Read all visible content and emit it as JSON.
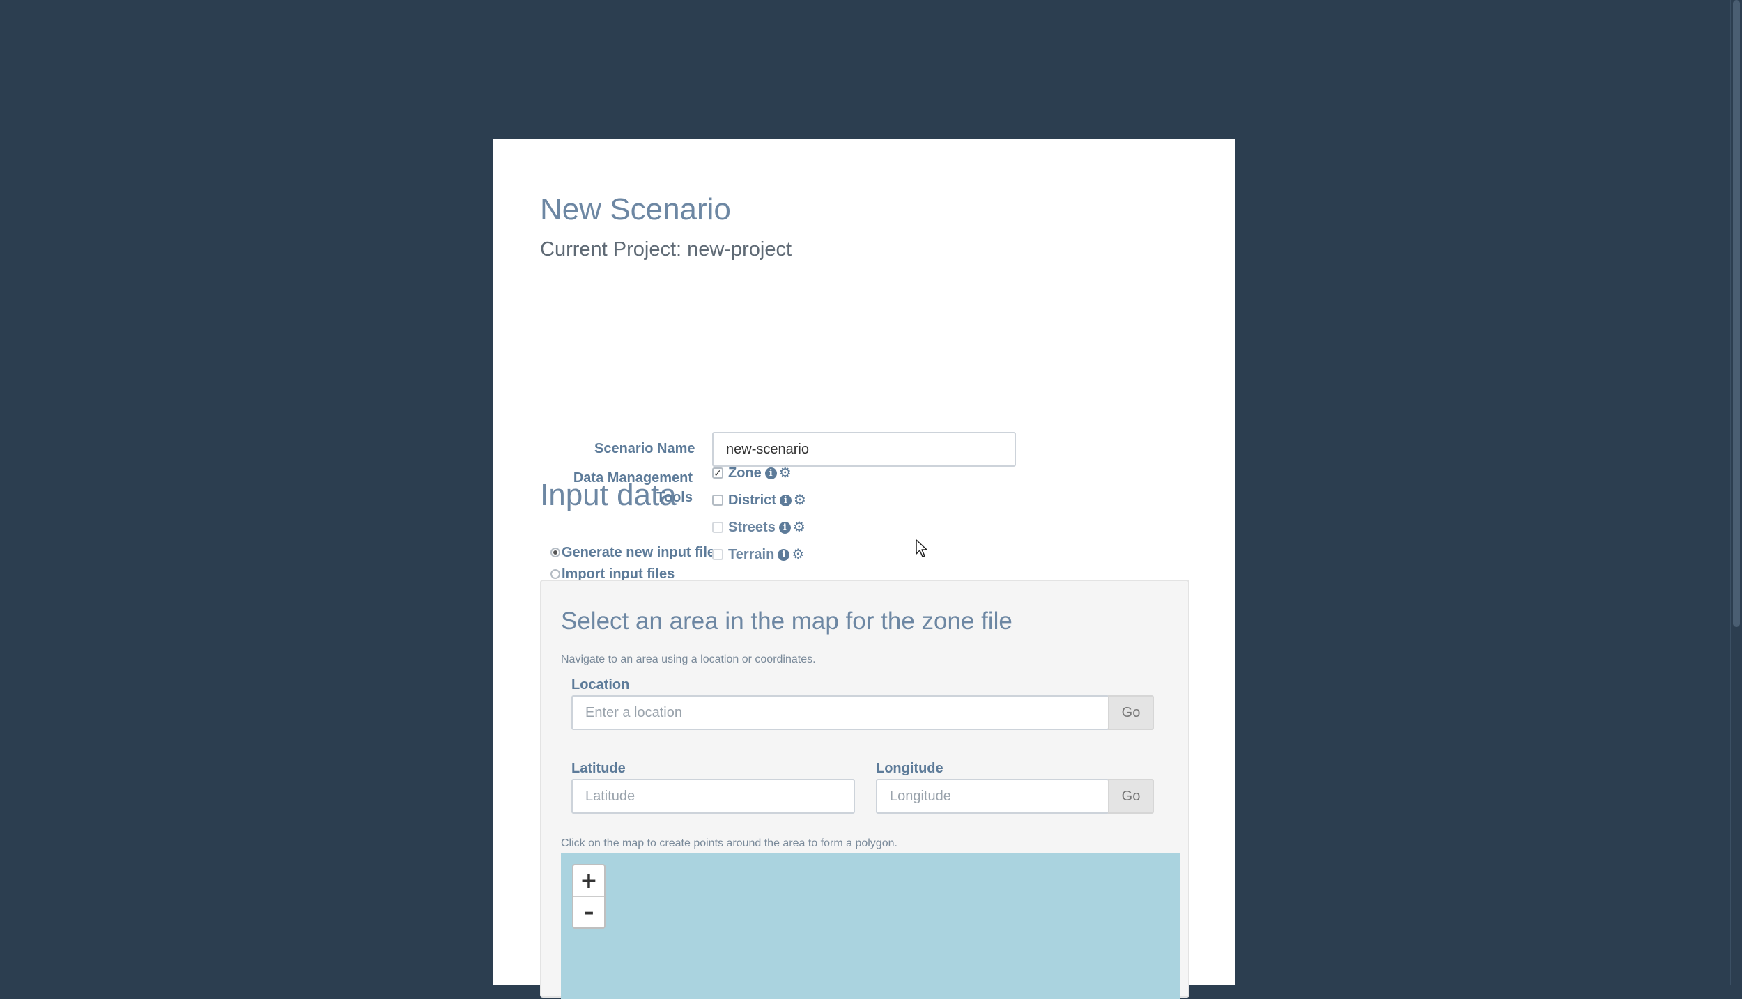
{
  "page": {
    "title": "New Scenario",
    "current_project": "Current Project: new-project",
    "scenario_name_label": "Scenario Name",
    "scenario_name_value": "new-scenario",
    "input_data_heading": "Input data"
  },
  "input_mode": {
    "options": [
      {
        "label": "Generate new input files",
        "checked": true
      },
      {
        "label": "Import input files",
        "checked": false
      }
    ]
  },
  "tools": {
    "label_line1": "Data Management",
    "label_line2": "Tools",
    "items": [
      {
        "label": "Zone",
        "checked": true,
        "enabled": true
      },
      {
        "label": "District",
        "checked": false,
        "enabled": true
      },
      {
        "label": "Streets",
        "checked": false,
        "enabled": false
      },
      {
        "label": "Terrain",
        "checked": false,
        "enabled": false
      }
    ]
  },
  "map_panel": {
    "title": "Select an area in the map for the zone file",
    "help_navigate": "Navigate to an area using a location or coordinates.",
    "location_label": "Location",
    "location_placeholder": "Enter a location",
    "go_label": "Go",
    "latitude_label": "Latitude",
    "latitude_placeholder": "Latitude",
    "longitude_label": "Longitude",
    "longitude_placeholder": "Longitude",
    "help_map": "Click on the map to create points around the area to form a polygon.",
    "zoom_in": "+",
    "zoom_out": "–"
  },
  "colors": {
    "background": "#2c3e50",
    "panel": "#ffffff",
    "heading": "#6d87a3",
    "label": "#5d7b99",
    "map_water": "#aad3df"
  },
  "icons": [
    "info-icon",
    "gear-icon",
    "cursor-icon"
  ]
}
